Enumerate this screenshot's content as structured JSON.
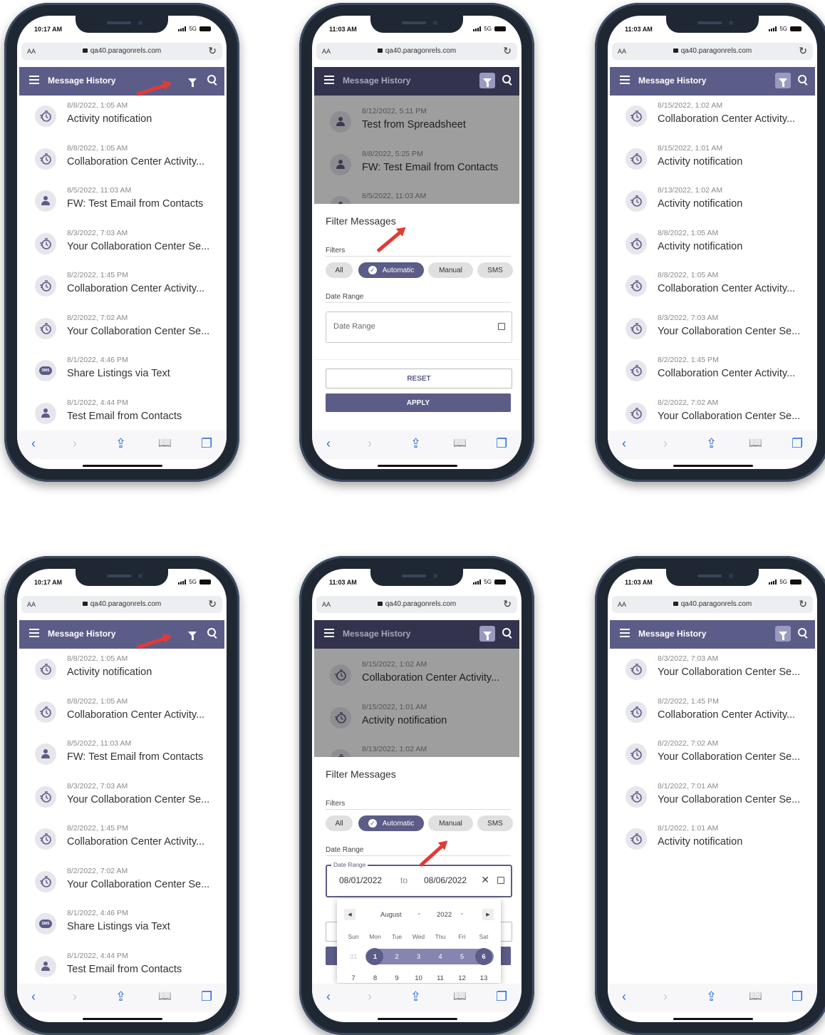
{
  "phones": [
    {
      "time": "10:17 AM",
      "carrier": "5G",
      "aa": "AA",
      "url": "qa40.paragonrels.com",
      "title": "Message History",
      "messages": [
        {
          "date": "8/8/2022, 1:05 AM",
          "subject": "Activity notification",
          "icon": "activity-icon"
        },
        {
          "date": "8/8/2022, 1:05 AM",
          "subject": "Collaboration Center Activity...",
          "icon": "activity-icon"
        },
        {
          "date": "8/5/2022, 11:03 AM",
          "subject": "FW: Test Email from Contacts",
          "icon": "person-icon"
        },
        {
          "date": "8/3/2022, 7:03 AM",
          "subject": "Your Collaboration Center Se...",
          "icon": "activity-icon"
        },
        {
          "date": "8/2/2022, 1:45 PM",
          "subject": "Collaboration Center Activity...",
          "icon": "activity-icon"
        },
        {
          "date": "8/2/2022, 7:02 AM",
          "subject": "Your Collaboration Center Se...",
          "icon": "activity-icon"
        },
        {
          "date": "8/1/2022, 4:46 PM",
          "subject": "Share Listings via Text",
          "icon": "sms-icon"
        },
        {
          "date": "8/1/2022, 4:44 PM",
          "subject": "Test Email from Contacts",
          "icon": "person-icon"
        }
      ]
    },
    {
      "time": "11:03 AM",
      "carrier": "5G",
      "aa": "AA",
      "url": "qa40.paragonrels.com",
      "title": "Message History",
      "messages": [
        {
          "date": "8/12/2022, 5:11 PM",
          "subject": "Test from Spreadsheet",
          "icon": "person-icon"
        },
        {
          "date": "8/8/2022, 5:25 PM",
          "subject": "FW: Test Email from Contacts",
          "icon": "person-icon"
        },
        {
          "date": "8/5/2022, 11:03 AM",
          "subject": "",
          "icon": "person-icon"
        }
      ],
      "filter_sheet": {
        "title": "Filter Messages",
        "filters_label": "Filters",
        "chips": [
          "All",
          "Automatic",
          "Manual",
          "SMS"
        ],
        "selected_chip": "Automatic",
        "check_glyph": "✓",
        "date_range_label": "Date Range",
        "date_range_placeholder": "Date Range",
        "reset_label": "RESET",
        "apply_label": "APPLY"
      }
    },
    {
      "time": "11:03 AM",
      "carrier": "5G",
      "aa": "AA",
      "url": "qa40.paragonrels.com",
      "title": "Message History",
      "messages": [
        {
          "date": "8/15/2022, 1:02 AM",
          "subject": "Collaboration Center Activity...",
          "icon": "activity-icon"
        },
        {
          "date": "8/15/2022, 1:01 AM",
          "subject": "Activity notification",
          "icon": "activity-icon"
        },
        {
          "date": "8/13/2022, 1:02 AM",
          "subject": "Activity notification",
          "icon": "activity-icon"
        },
        {
          "date": "8/8/2022, 1:05 AM",
          "subject": "Activity notification",
          "icon": "activity-icon"
        },
        {
          "date": "8/8/2022, 1:05 AM",
          "subject": "Collaboration Center Activity...",
          "icon": "activity-icon"
        },
        {
          "date": "8/3/2022, 7:03 AM",
          "subject": "Your Collaboration Center Se...",
          "icon": "activity-icon"
        },
        {
          "date": "8/2/2022, 1:45 PM",
          "subject": "Collaboration Center Activity...",
          "icon": "activity-icon"
        },
        {
          "date": "8/2/2022, 7:02 AM",
          "subject": "Your Collaboration Center Se...",
          "icon": "activity-icon"
        }
      ]
    },
    {
      "time": "10:17 AM",
      "carrier": "5G",
      "aa": "AA",
      "url": "qa40.paragonrels.com",
      "title": "Message History",
      "messages": [
        {
          "date": "8/8/2022, 1:05 AM",
          "subject": "Activity notification",
          "icon": "activity-icon"
        },
        {
          "date": "8/8/2022, 1:05 AM",
          "subject": "Collaboration Center Activity...",
          "icon": "activity-icon"
        },
        {
          "date": "8/5/2022, 11:03 AM",
          "subject": "FW: Test Email from Contacts",
          "icon": "person-icon"
        },
        {
          "date": "8/3/2022, 7:03 AM",
          "subject": "Your Collaboration Center Se...",
          "icon": "activity-icon"
        },
        {
          "date": "8/2/2022, 1:45 PM",
          "subject": "Collaboration Center Activity...",
          "icon": "activity-icon"
        },
        {
          "date": "8/2/2022, 7:02 AM",
          "subject": "Your Collaboration Center Se...",
          "icon": "activity-icon"
        },
        {
          "date": "8/1/2022, 4:46 PM",
          "subject": "Share Listings via Text",
          "icon": "sms-icon"
        },
        {
          "date": "8/1/2022, 4:44 PM",
          "subject": "Test Email from Contacts",
          "icon": "person-icon"
        }
      ]
    },
    {
      "time": "11:03 AM",
      "carrier": "5G",
      "aa": "AA",
      "url": "qa40.paragonrels.com",
      "title": "Message History",
      "messages": [
        {
          "date": "8/15/2022, 1:02 AM",
          "subject": "Collaboration Center Activity...",
          "icon": "activity-icon"
        },
        {
          "date": "8/15/2022, 1:01 AM",
          "subject": "Activity notification",
          "icon": "activity-icon"
        },
        {
          "date": "8/13/2022, 1:02 AM",
          "subject": "",
          "icon": "activity-icon"
        }
      ],
      "filter_sheet": {
        "title": "Filter Messages",
        "filters_label": "Filters",
        "chips": [
          "All",
          "Automatic",
          "Manual",
          "SMS"
        ],
        "selected_chip": "Automatic",
        "check_glyph": "✓",
        "date_range_label": "Date Range",
        "date_range_legend": "Date Range",
        "from_value": "08/01/2022",
        "to_label": "to",
        "to_value": "08/06/2022",
        "clear_glyph": "✕",
        "calendar": {
          "prev": "◀",
          "next": "▶",
          "month": "August",
          "year": "2022",
          "caret": "⌄",
          "weekdays": [
            "Sun",
            "Mon",
            "Tue",
            "Wed",
            "Thu",
            "Fri",
            "Sat"
          ],
          "week1": [
            "31",
            "1",
            "2",
            "3",
            "4",
            "5",
            "6"
          ],
          "week2": [
            "7",
            "8",
            "9",
            "10",
            "11",
            "12",
            "13"
          ]
        }
      }
    },
    {
      "time": "11:03 AM",
      "carrier": "5G",
      "aa": "AA",
      "url": "qa40.paragonrels.com",
      "title": "Message History",
      "messages": [
        {
          "date": "8/3/2022, 7:03 AM",
          "subject": "Your Collaboration Center Se...",
          "icon": "activity-icon"
        },
        {
          "date": "8/2/2022, 1:45 PM",
          "subject": "Collaboration Center Activity...",
          "icon": "activity-icon"
        },
        {
          "date": "8/2/2022, 7:02 AM",
          "subject": "Your Collaboration Center Se...",
          "icon": "activity-icon"
        },
        {
          "date": "8/1/2022, 7:01 AM",
          "subject": "Your Collaboration Center Se...",
          "icon": "activity-icon"
        },
        {
          "date": "8/1/2022, 1:01 AM",
          "subject": "Activity notification",
          "icon": "activity-icon"
        }
      ]
    }
  ],
  "toolbar_glyphs": {
    "back": "‹",
    "forward": "›",
    "share": "⇪",
    "bookmarks": "📖",
    "tabs": "❐",
    "reload": "↻"
  },
  "colors": {
    "header": "#5c5c88",
    "accent": "#5c5c88",
    "arrow": "#e23a35",
    "link_blue": "#2b6fd8"
  }
}
